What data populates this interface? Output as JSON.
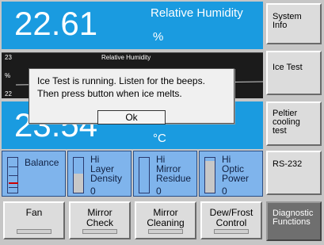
{
  "humidity": {
    "value": "22.61",
    "title": "Relative Humidity",
    "unit": "%"
  },
  "graph": {
    "title": "Relative Humidity",
    "max_label": "23",
    "unit_label": "%",
    "min_label": "22"
  },
  "temperature": {
    "value": "23.54",
    "unit": "°C"
  },
  "status": {
    "balance": {
      "label": "Balance"
    },
    "layer_density": {
      "level": "Hi",
      "line1": "Layer",
      "line2": "Density",
      "reading": "0",
      "fill_fraction": 0.55
    },
    "mirror_residue": {
      "level": "Hi",
      "line1": "Mirror",
      "line2": "Residue",
      "reading": "0",
      "fill_fraction": 0.0
    },
    "optic_power": {
      "level": "Hi",
      "line1": "Optic",
      "line2": "Power",
      "reading": "0",
      "fill_fraction": 0.9
    }
  },
  "bottom_buttons": [
    {
      "line1": "Fan",
      "line2": ""
    },
    {
      "line1": "Mirror",
      "line2": "Check"
    },
    {
      "line1": "Mirror",
      "line2": "Cleaning"
    },
    {
      "line1": "Dew/Frost",
      "line2": "Control"
    }
  ],
  "side_buttons": {
    "system_info": [
      "System",
      "Info"
    ],
    "ice_test": [
      "Ice Test"
    ],
    "peltier": [
      "Peltier",
      "cooling",
      "test"
    ],
    "rs232": [
      "RS-232"
    ],
    "diagnostic": [
      "Diagnostic",
      "Functions"
    ]
  },
  "dialog": {
    "line1": "Ice Test is running. Listen for the beeps.",
    "line2": "Then press button when ice melts.",
    "ok_label": "Ok"
  },
  "colors": {
    "readout_blue": "#1a9be0",
    "status_blue": "#7fb4ec",
    "diagnostic_active": "#6f6f6f"
  }
}
